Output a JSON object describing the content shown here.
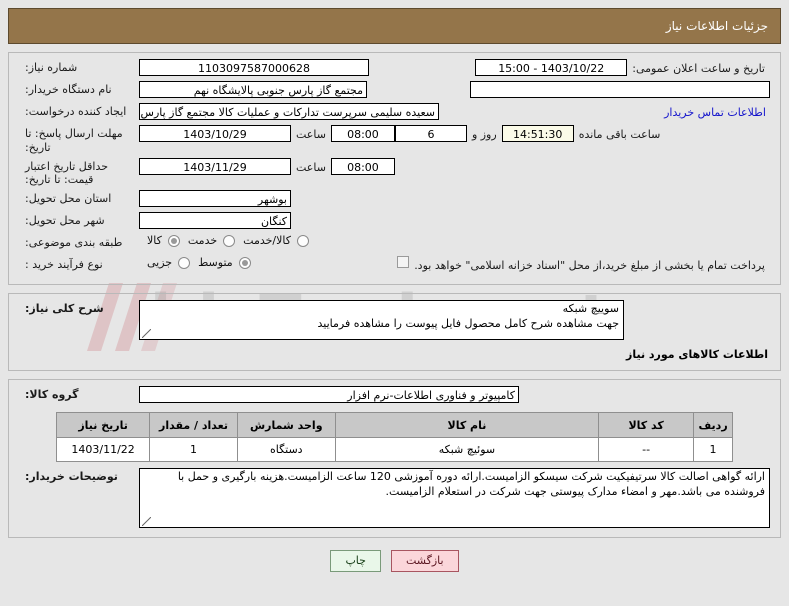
{
  "header": {
    "title": "جزئیات اطلاعات نیاز",
    "bar_color": "#94754a"
  },
  "form": {
    "need_number": {
      "label": "شماره نیاز:",
      "value": "1103097587000628"
    },
    "announce": {
      "label": "تاریخ و ساعت اعلان عمومی:",
      "value": "15:00 - 1403/10/22"
    },
    "buyer_org": {
      "label": "نام دستگاه خریدار:",
      "value": "مجتمع گاز پارس جنوبی  پالایشگاه نهم"
    },
    "buyer_org_left": {
      "value": ""
    },
    "creator": {
      "label": "ایجاد کننده درخواست:",
      "value": "سعیده سلیمی سرپرست تدارکات و عملیات کالا مجتمع گاز پارس جنوبی  پالایش",
      "link": "اطلاعات تماس خریدار"
    },
    "reply_deadline": {
      "label": "مهلت ارسال پاسخ: تا تاریخ:",
      "date": "1403/10/29",
      "hour_label": "ساعت",
      "hour": "08:00",
      "days": "6",
      "days_label": "روز و",
      "countdown": "14:51:30",
      "countdown_label": "ساعت باقی مانده"
    },
    "price_validity": {
      "label": "حداقل تاریخ اعتبار قیمت: تا تاریخ:",
      "date": "1403/11/29",
      "hour_label": "ساعت",
      "hour": "08:00"
    },
    "province": {
      "label": "استان محل تحویل:",
      "value": "بوشهر"
    },
    "city": {
      "label": "شهر محل تحویل:",
      "value": "کنگان"
    },
    "subject_class": {
      "label": "طبقه بندی موضوعی:",
      "options": [
        {
          "label": "کالا",
          "selected": true
        },
        {
          "label": "خدمت",
          "selected": false
        },
        {
          "label": "کالا/خدمت",
          "selected": false
        }
      ]
    },
    "purchase_type": {
      "label": "نوع فرآیند خرید :",
      "options": [
        {
          "label": "جزیی",
          "selected": false
        },
        {
          "label": "متوسط",
          "selected": true
        }
      ],
      "checkbox_label": "پرداخت تمام یا بخشی از مبلغ خرید،از محل \"اسناد خزانه اسلامی\" خواهد بود.",
      "checkbox_checked": false
    }
  },
  "description": {
    "label": "شرح کلی نیاز:",
    "value": "سوییچ شبکه\nجهت مشاهده شرح کامل محصول فایل پیوست را مشاهده فرمایید"
  },
  "goods_section": {
    "title": "اطلاعات کالاهای مورد نیاز",
    "group": {
      "label": "گروه کالا:",
      "value": "کامپیوتر و فناوری اطلاعات-نرم افزار"
    },
    "table": {
      "columns": [
        "ردیف",
        "کد کالا",
        "نام کالا",
        "واحد شمارش",
        "تعداد / مقدار",
        "تاریخ نیاز"
      ],
      "rows": [
        {
          "radif": "1",
          "code": "--",
          "name": "سوئیچ شبکه",
          "unit": "دستگاه",
          "qty": "1",
          "date": "1403/11/22"
        }
      ]
    }
  },
  "notes": {
    "label": "توضیحات خریدار:",
    "value": "ارائه گواهی اصالت کالا سرتیفیکیت شرکت سیسکو الزامیست.ارائه دوره آموزشی 120 ساعت الزامیست.هزینه بارگیری و حمل با فروشنده می باشد.مهر و امضاﺀ مدارک پیوستی جهت شرکت در استعلام الزامیست."
  },
  "footer": {
    "print_label": "چاپ",
    "back_label": "بازگشت"
  },
  "watermark": {
    "text": "irinTender.net"
  }
}
